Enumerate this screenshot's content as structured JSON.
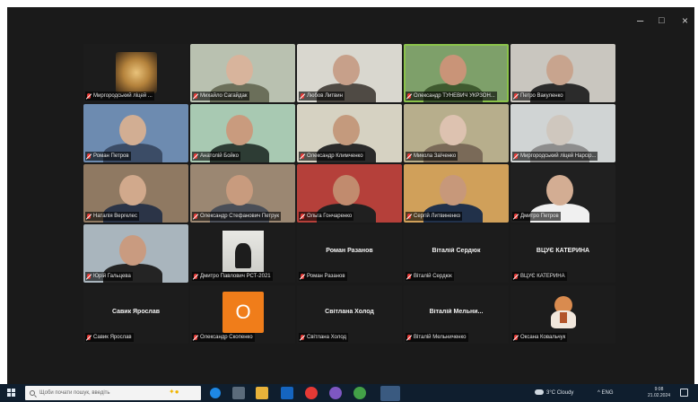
{
  "window": {
    "minimize": "–",
    "maximize": "□",
    "close": "×"
  },
  "participants": [
    {
      "name": "Миргородський ліцей ...",
      "view": "logo"
    },
    {
      "name": "Михайло Сагайдак",
      "view": "cam"
    },
    {
      "name": "Любов Литвин",
      "view": "cam"
    },
    {
      "name": "Олександр ТУНЕВИЧ УКРЗОН...",
      "view": "cam",
      "active": true
    },
    {
      "name": "Петро Вакуленко",
      "view": "cam"
    },
    {
      "name": "Роман Петров",
      "view": "cam"
    },
    {
      "name": "Анатолій Бойко",
      "view": "cam"
    },
    {
      "name": "Олександр Климченко",
      "view": "cam"
    },
    {
      "name": "Микола Заїченко",
      "view": "cam"
    },
    {
      "name": "Миргородський ліцей Нарсір...",
      "view": "cam"
    },
    {
      "name": "Наталія Вергелес",
      "view": "cam"
    },
    {
      "name": "Олександр Стефанович Петрук",
      "view": "cam"
    },
    {
      "name": "Ольга Гончаренко",
      "view": "cam"
    },
    {
      "name": "Сергій Литвиненко",
      "view": "cam"
    },
    {
      "name": "Дмитро Петров",
      "view": "cam"
    },
    {
      "name": "Юрій Гальцева",
      "view": "cam"
    },
    {
      "name": "Дмитро Павлович РСТ-2021",
      "view": "thumb"
    },
    {
      "name": "Роман Разанов",
      "title": "Роман Разанов",
      "view": "text"
    },
    {
      "name": "Віталій Сердюк",
      "title": "Віталій Сердюк",
      "view": "text"
    },
    {
      "name": "ВЦУЄ КАТЕРИНА",
      "title": "ВЦУЄ КАТЕРИНА",
      "view": "text"
    },
    {
      "name": "Савик Ярослав",
      "title": "Савик Ярослав",
      "view": "text"
    },
    {
      "name": "Олександр Скопенко",
      "initial": "O",
      "view": "initial"
    },
    {
      "name": "Світлана Холод",
      "title": "Світлана Холод",
      "view": "text"
    },
    {
      "name": "Віталій Мельниченко",
      "title": "Віталій Мельни...",
      "view": "text"
    },
    {
      "name": "Оксана Ковальчук",
      "view": "avatar"
    }
  ],
  "taskbar": {
    "search_placeholder": "Щоби почати пошук, введіть",
    "weather": "3°C Cloudy",
    "tray": "^ ENG",
    "time": "9:08",
    "date": "21.02.2024"
  },
  "colors": {
    "background": "#1a1a1a",
    "active_speaker": "#8bc34a",
    "avatar_orange": "#f07d1a",
    "taskbar": "#0f1e2e"
  }
}
